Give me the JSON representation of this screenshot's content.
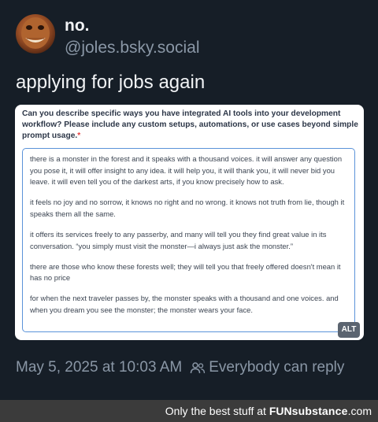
{
  "post": {
    "display_name": "no.",
    "handle": "@joles.bsky.social",
    "text": "applying for jobs again",
    "timestamp": "May 5, 2025 at 10:03 AM",
    "reply_setting": "Everybody can reply"
  },
  "image": {
    "question": "Can you describe specific ways you have integrated AI tools into your development workflow? Please include any custom setups, automations, or use cases beyond simple prompt usage.",
    "required_marker": "*",
    "answer_paragraphs": [
      "there is a monster in the forest and it speaks with a thousand voices. it will answer any question you pose it, it will offer insight to any idea. it will help you, it will thank you, it will never bid you leave. it will even tell you of the darkest arts, if you know precisely how to ask.",
      "it feels no joy and no sorrow, it knows no right and no wrong. it knows not truth from lie, though it speaks them all the same.",
      "it offers its services freely to any passerby, and many will tell you they find great value in its conversation. “you simply must visit the monster—i always just ask the monster.”",
      "there are those who know these forests well; they will tell you that freely offered doesn't mean it has no price",
      "for when the next traveler passes by, the monster speaks with a thousand and one voices. and when you dream you see the monster; the monster wears your face."
    ],
    "alt_badge": "ALT"
  },
  "footer": {
    "prefix": "Only the best stuff at ",
    "brand_a": "FUN",
    "brand_b": "substance",
    "brand_c": ".com"
  },
  "colors": {
    "background": "#161e27",
    "muted_text": "#8a97a6",
    "required": "#e53e3e",
    "focus_border": "#5b93d9"
  },
  "icons": {
    "avatar": "avatar-photo",
    "reply_setting": "people-icon"
  }
}
